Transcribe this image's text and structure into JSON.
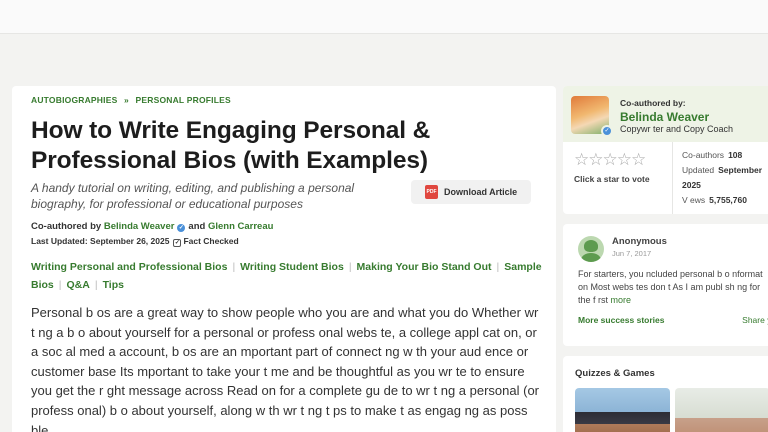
{
  "breadcrumb": [
    "AUTOBIOGRAPHIES",
    "PERSONAL PROFILES"
  ],
  "breadcrumb_sep": "»",
  "article": {
    "title": "How to Write Engaging Personal & Professional Bios (with Examples)",
    "subtitle": "A handy tutorial on writing, editing, and publishing a personal biography, for professional or educational purposes",
    "download_label": "Download Article",
    "download_icon": "PDF",
    "coauthored_prefix": "Co-authored by",
    "author1": "Belinda Weaver",
    "and_text": "and",
    "author2": "Glenn Carreau",
    "last_updated_label": "Last Updated:",
    "last_updated": "September 26, 2025",
    "fact_checked": "Fact Checked",
    "toc": [
      "Writing Personal and Professional Bios",
      "Writing Student Bios",
      "Making Your Bio Stand Out",
      "Sample Bios",
      "Q&A",
      "Tips"
    ],
    "body": "Personal b os are a great way to show people who you are and what you do Whether wr t ng a b o about yourself for a personal or profess onal webs te, a college appl cat on, or a soc al med a account, b os are an mportant part of connect ng w th your aud ence or customer base Its mportant to take your t me and be thoughtful as you wr te to ensure you get the r ght message across Read on for a complete gu de to wr t ng a personal (or profess onal) b o about yourself, along w th wr t ng t ps to make t as engag ng as poss ble"
  },
  "author_card": {
    "label": "Co-authored by:",
    "name": "Belinda Weaver",
    "role": "Copywr ter and Copy Coach",
    "stars": "☆☆☆☆☆",
    "rate_text": "Click a star to vote",
    "coauthors_label": "Co-authors",
    "coauthors": "108",
    "updated_label": "Updated",
    "updated": "September",
    "updated_year": "2025",
    "views_label": "V ews",
    "views": "5,755,760"
  },
  "story_card": {
    "name": "Anonymous",
    "date": "Jun 7, 2017",
    "text": "For starters, you ncluded personal b o nformat on Most webs tes don t As I am publ sh ng for the f rst",
    "more": "more",
    "more_stories": "More success stories",
    "share": "Share yours"
  },
  "quiz_card": {
    "title": "Quizzes & Games"
  }
}
